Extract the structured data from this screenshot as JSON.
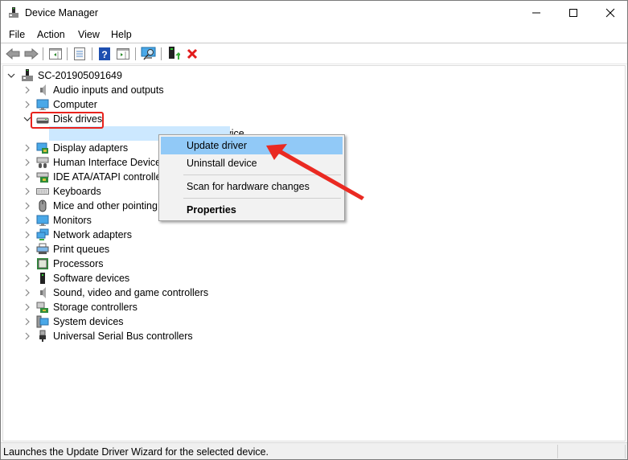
{
  "window": {
    "title": "Device Manager",
    "controls": {
      "minimize": "minimize",
      "maximize": "maximize",
      "close": "close"
    }
  },
  "menu": [
    "File",
    "Action",
    "View",
    "Help"
  ],
  "toolbar": [
    {
      "icon": "back-arrow-icon"
    },
    {
      "icon": "forward-arrow-icon"
    },
    {
      "icon": "show-hide-console-tree-icon"
    },
    {
      "icon": "properties-icon"
    },
    {
      "icon": "help-icon"
    },
    {
      "icon": "show-action-pane-icon"
    },
    {
      "icon": "scan-hardware-icon"
    },
    {
      "icon": "update-driver-icon"
    },
    {
      "icon": "uninstall-device-icon"
    }
  ],
  "tree": {
    "root": "SC-201905091649",
    "categories": [
      {
        "label": "Audio inputs and outputs",
        "icon": "speaker-icon",
        "expanded": false
      },
      {
        "label": "Computer",
        "icon": "monitor-icon",
        "expanded": false
      },
      {
        "label": "Disk drives",
        "icon": "disk-drive-icon",
        "expanded": true,
        "children": [
          "MG  BG400M8  SSD 256GB ATA Device"
        ]
      },
      {
        "label": "Display adapters",
        "icon": "display-adapter-icon",
        "expanded": false
      },
      {
        "label": "Human Interface Devices",
        "icon": "hid-icon",
        "expanded": false
      },
      {
        "label": "IDE ATA/ATAPI controllers",
        "icon": "ide-controller-icon",
        "expanded": false
      },
      {
        "label": "Keyboards",
        "icon": "keyboard-icon",
        "expanded": false
      },
      {
        "label": "Mice and other pointing devices",
        "icon": "mouse-icon",
        "expanded": false
      },
      {
        "label": "Monitors",
        "icon": "monitor-icon",
        "expanded": false
      },
      {
        "label": "Network adapters",
        "icon": "network-icon",
        "expanded": false
      },
      {
        "label": "Print queues",
        "icon": "printer-icon",
        "expanded": false
      },
      {
        "label": "Processors",
        "icon": "processor-icon",
        "expanded": false
      },
      {
        "label": "Software devices",
        "icon": "software-device-icon",
        "expanded": false
      },
      {
        "label": "Sound, video and game controllers",
        "icon": "speaker-icon",
        "expanded": false
      },
      {
        "label": "Storage controllers",
        "icon": "storage-controller-icon",
        "expanded": false
      },
      {
        "label": "System devices",
        "icon": "system-device-icon",
        "expanded": false
      },
      {
        "label": "Universal Serial Bus controllers",
        "icon": "usb-icon",
        "expanded": false
      }
    ]
  },
  "context_menu": {
    "items": [
      {
        "label": "Update driver",
        "highlighted": true
      },
      {
        "label": "Uninstall device"
      },
      {
        "label": "Scan for hardware changes"
      },
      {
        "label": "Properties",
        "bold": true
      }
    ]
  },
  "annotation": {
    "color": "#e8221c"
  },
  "status_bar": {
    "text": "Launches the Update Driver Wizard for the selected device."
  }
}
